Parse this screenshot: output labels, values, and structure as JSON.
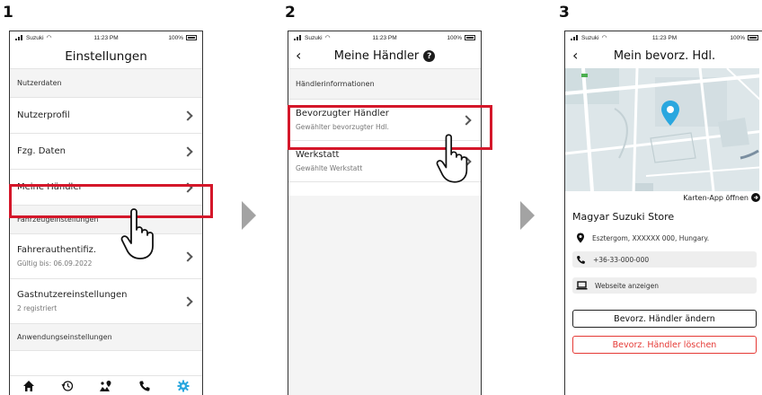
{
  "steps": [
    "1",
    "2",
    "3"
  ],
  "status": {
    "carrier": "Suzuki",
    "time": "11:23 PM",
    "battery": "100%"
  },
  "screen1": {
    "title": "Einstellungen",
    "section_user": "Nutzerdaten",
    "items_user": [
      {
        "label": "Nutzerprofil"
      },
      {
        "label": "Fzg. Daten"
      },
      {
        "label": "Meine Händler"
      }
    ],
    "section_vehicle": "Fahrzeugeinstellungen",
    "items_vehicle": [
      {
        "label": "Fahrerauthentifiz.",
        "sub": "Gültig bis: 06.09.2022"
      },
      {
        "label": "Gastnutzereinstellungen",
        "sub": "2 registriert"
      }
    ],
    "section_app": "Anwendungseinstellungen",
    "tabs": [
      "home-icon",
      "history-icon",
      "map-icon",
      "phone-icon",
      "gear-icon"
    ]
  },
  "screen2": {
    "title": "Meine Händler",
    "section": "Händlerinformationen",
    "items": [
      {
        "label": "Bevorzugter Händler",
        "sub": "Gewählter bevorzugter Hdl."
      },
      {
        "label": "Werkstatt",
        "sub": "Gewählte Werkstatt"
      }
    ]
  },
  "screen3": {
    "title": "Mein bevorz. Hdl.",
    "map_link": "Karten-App öffnen",
    "dealer_name": "Magyar Suzuki Store",
    "address": "Esztergom, XXXXXX 000, Hungary.",
    "phone": "+36-33-000-000",
    "website": "Webseite anzeigen",
    "change_button": "Bevorz. Händler ändern",
    "delete_button": "Bevorz. Händler löschen"
  },
  "colors": {
    "highlight": "#d4172a",
    "accent_tab": "#2aa7df",
    "danger": "#e53935",
    "map_pin": "#2aa7df"
  }
}
